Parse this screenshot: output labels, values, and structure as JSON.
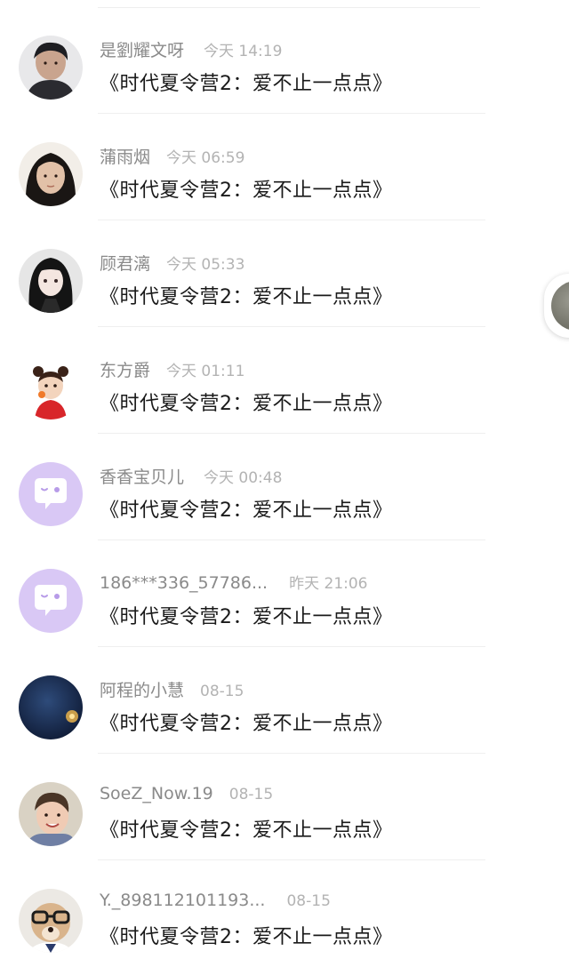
{
  "items": [
    {
      "name": "是劉耀文呀",
      "time": "今天 14:19",
      "content": "《时代夏令营2：爱不止一点点》",
      "avatar": "boy-photo-avatar"
    },
    {
      "name": "蒲雨烟",
      "time": "今天 06:59",
      "content": "《时代夏令营2：爱不止一点点》",
      "avatar": "girl-photo-avatar"
    },
    {
      "name": "顾君漓",
      "time": "今天 05:33",
      "content": "《时代夏令营2：爱不止一点点》",
      "avatar": "anime-girl-avatar"
    },
    {
      "name": "东方爵",
      "time": "今天 01:11",
      "content": "《时代夏令营2：爱不止一点点》",
      "avatar": "cartoon-girl-avatar"
    },
    {
      "name": "香香宝贝儿",
      "time": "今天 00:48",
      "content": "《时代夏令营2：爱不止一点点》",
      "avatar": "default-chat-avatar"
    },
    {
      "name": "186***336_57786...",
      "time": "昨天 21:06",
      "content": "《时代夏令营2：爱不止一点点》",
      "avatar": "default-chat-avatar"
    },
    {
      "name": "阿程的小慧",
      "time": "08-15",
      "content": "《时代夏令营2：爱不止一点点》",
      "avatar": "night-sky-avatar"
    },
    {
      "name": "SoeZ_Now.19",
      "time": "08-15",
      "content": "《时代夏令营2：爱不止一点点》",
      "avatar": "boy-smile-avatar"
    },
    {
      "name": "Y._898112101193...",
      "time": "08-15",
      "content": "《时代夏令营2：爱不止一点点》",
      "avatar": "dog-glasses-avatar"
    }
  ],
  "colors": {
    "name": "#8a8a8a",
    "time": "#b3b3b3",
    "content": "#1a1a1a",
    "default_avatar_bg": "#d9c8f5",
    "divider": "#efefef"
  }
}
